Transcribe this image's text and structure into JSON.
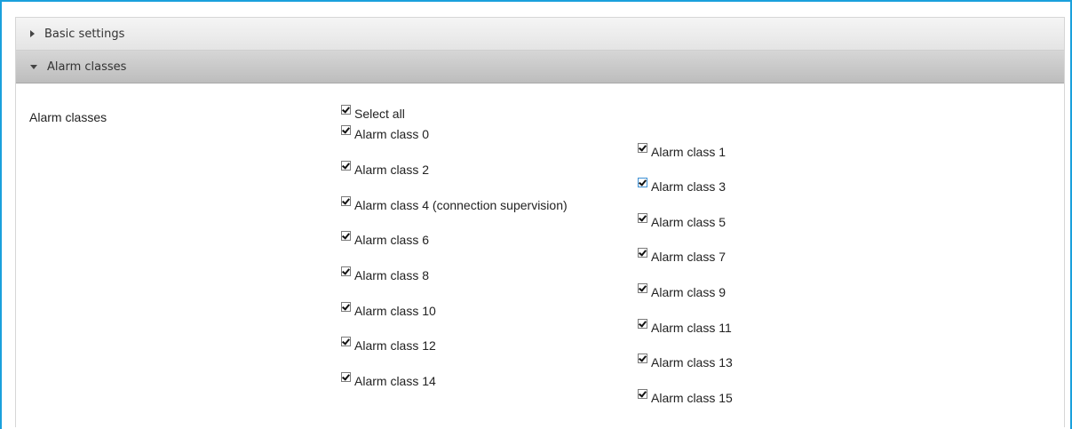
{
  "sections": {
    "basic": {
      "title": "Basic settings"
    },
    "alarm": {
      "title": "Alarm classes"
    }
  },
  "form": {
    "field_label": "Alarm classes",
    "select_all": {
      "label": "Select all",
      "checked": true
    },
    "left_column": [
      {
        "label": "Alarm class 0",
        "checked": true
      },
      {
        "label": "Alarm class 2",
        "checked": true
      },
      {
        "label": "Alarm class 4 (connection supervision)",
        "checked": true
      },
      {
        "label": "Alarm class 6",
        "checked": true
      },
      {
        "label": "Alarm class 8",
        "checked": true
      },
      {
        "label": "Alarm class 10",
        "checked": true
      },
      {
        "label": "Alarm class 12",
        "checked": true
      },
      {
        "label": "Alarm class 14",
        "checked": true
      }
    ],
    "right_column": [
      {
        "label": "Alarm class 1",
        "checked": true
      },
      {
        "label": "Alarm class 3",
        "checked": true
      },
      {
        "label": "Alarm class 5",
        "checked": true
      },
      {
        "label": "Alarm class 7",
        "checked": true
      },
      {
        "label": "Alarm class 9",
        "checked": true
      },
      {
        "label": "Alarm class 11",
        "checked": true
      },
      {
        "label": "Alarm class 13",
        "checked": true
      },
      {
        "label": "Alarm class 15",
        "checked": true
      }
    ]
  },
  "colors": {
    "frame_border": "#1aa0dc",
    "focus_checkbox": "#3c8fd4"
  }
}
